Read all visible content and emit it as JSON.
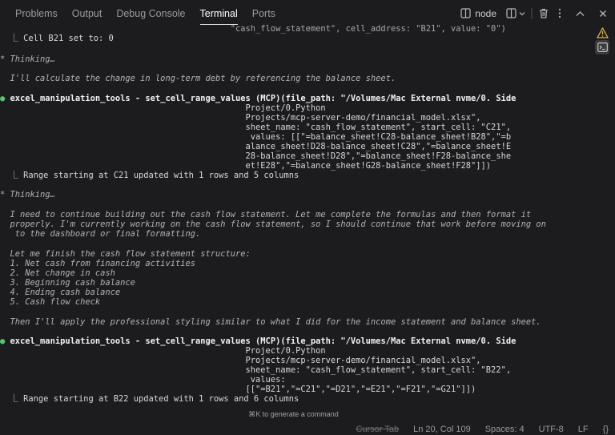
{
  "tabs": [
    {
      "label": "Problems"
    },
    {
      "label": "Output"
    },
    {
      "label": "Debug Console"
    },
    {
      "label": "Terminal",
      "active": true
    },
    {
      "label": "Ports"
    }
  ],
  "terminal": {
    "name": "node",
    "lines": [
      "                                              \"cash_flow_statement\", cell_address: \"B21\", value: \"0\")",
      "  ⎿ Cell B21 set to: 0",
      "",
      "* Thinking…",
      "",
      "  I'll calculate the change in long-term debt by referencing the balance sheet.",
      "",
      "● excel_manipulation_tools - set_cell_range_values (MCP)(file_path: \"/Volumes/Mac External nvme/0. Side",
      "                                                 Project/0.Python",
      "                                                 Projects/mcp-server-demo/financial_model.xlsx\",",
      "                                                 sheet_name: \"cash_flow_statement\", start_cell: \"C21\",",
      "                                                  values: [[\"=balance_sheet!C28-balance_sheet!B28\",\"=b",
      "                                                 alance_sheet!D28-balance_sheet!C28\",\"=balance_sheet!E",
      "                                                 28-balance_sheet!D28\",\"=balance_sheet!F28-balance_she",
      "                                                 et!E28\",\"=balance_sheet!G28-balance_sheet!F28\"]])",
      "  ⎿ Range starting at C21 updated with 1 rows and 5 columns",
      "",
      "* Thinking…",
      "",
      "  I need to continue building out the cash flow statement. Let me complete the formulas and then format it",
      "  properly. I'm currently working on the cash flow statement, so I should continue that work before moving on",
      "   to the dashboard or final formatting.",
      "",
      "  Let me finish the cash flow statement structure:",
      "  1. Net cash from financing activities",
      "  2. Net change in cash",
      "  3. Beginning cash balance",
      "  4. Ending cash balance",
      "  5. Cash flow check",
      "",
      "  Then I'll apply the professional styling similar to what I did for the income statement and balance sheet.",
      "",
      "● excel_manipulation_tools - set_cell_range_values (MCP)(file_path: \"/Volumes/Mac External nvme/0. Side",
      "                                                 Project/0.Python",
      "                                                 Projects/mcp-server-demo/financial_model.xlsx\",",
      "                                                 sheet_name: \"cash_flow_statement\", start_cell: \"B22\",",
      "                                                  values:",
      "                                                 [[\"=B21\",\"=C21\",\"=D21\",\"=E21\",\"=F21\",\"=G21\"]])",
      "  ⎿ Range starting at B22 updated with 1 rows and 6 columns"
    ]
  },
  "hint": "⌘K to generate a command",
  "status": {
    "cursor_tab": "Cursor Tab",
    "position": "Ln 20, Col 109",
    "spaces": "Spaces: 4",
    "encoding": "UTF-8",
    "eol": "LF",
    "braces": "{}"
  },
  "colors": {
    "background": "#1c1c1e",
    "success_dot": "#4ec96b",
    "warning": "#e2b93b"
  }
}
